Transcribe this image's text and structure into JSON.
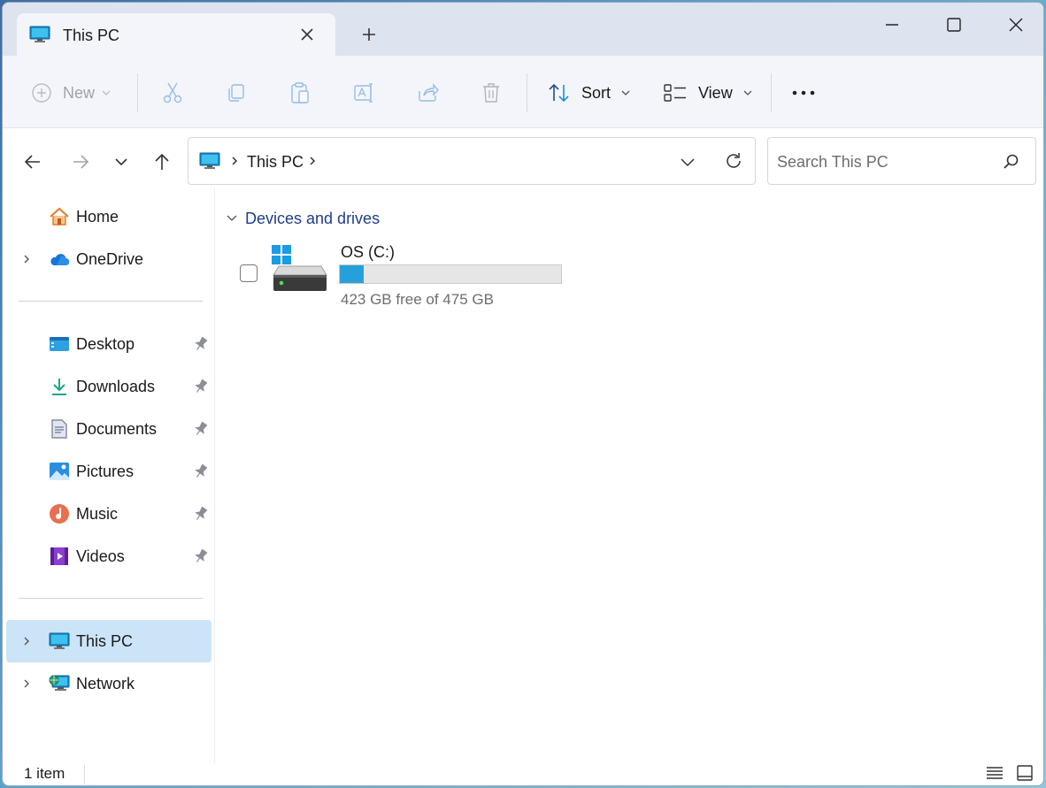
{
  "window": {
    "tab_title": "This PC",
    "controls": {
      "minimize": "minimize-icon",
      "maximize": "maximize-icon",
      "close": "close-icon"
    }
  },
  "toolbar": {
    "new_label": "New",
    "sort_label": "Sort",
    "view_label": "View",
    "icons": [
      "cut-icon",
      "copy-icon",
      "paste-icon",
      "rename-icon",
      "share-icon",
      "delete-icon",
      "more-icon"
    ]
  },
  "address": {
    "crumbs": [
      "This PC"
    ]
  },
  "search": {
    "placeholder": "Search This PC"
  },
  "sidebar": {
    "items": [
      {
        "label": "Home"
      },
      {
        "label": "OneDrive"
      },
      {
        "label": "Desktop"
      },
      {
        "label": "Downloads"
      },
      {
        "label": "Documents"
      },
      {
        "label": "Pictures"
      },
      {
        "label": "Music"
      },
      {
        "label": "Videos"
      },
      {
        "label": "This PC"
      },
      {
        "label": "Network"
      }
    ]
  },
  "content": {
    "group_label": "Devices and drives",
    "drives": [
      {
        "name": "OS (C:)",
        "free_text": "423 GB free of 475 GB",
        "used_fraction": 0.109
      }
    ]
  },
  "status": {
    "item_count": "1 item"
  },
  "colors": {
    "accent": "#26a0da",
    "selected": "#cce4f7",
    "group_header": "#1f3d8a"
  }
}
